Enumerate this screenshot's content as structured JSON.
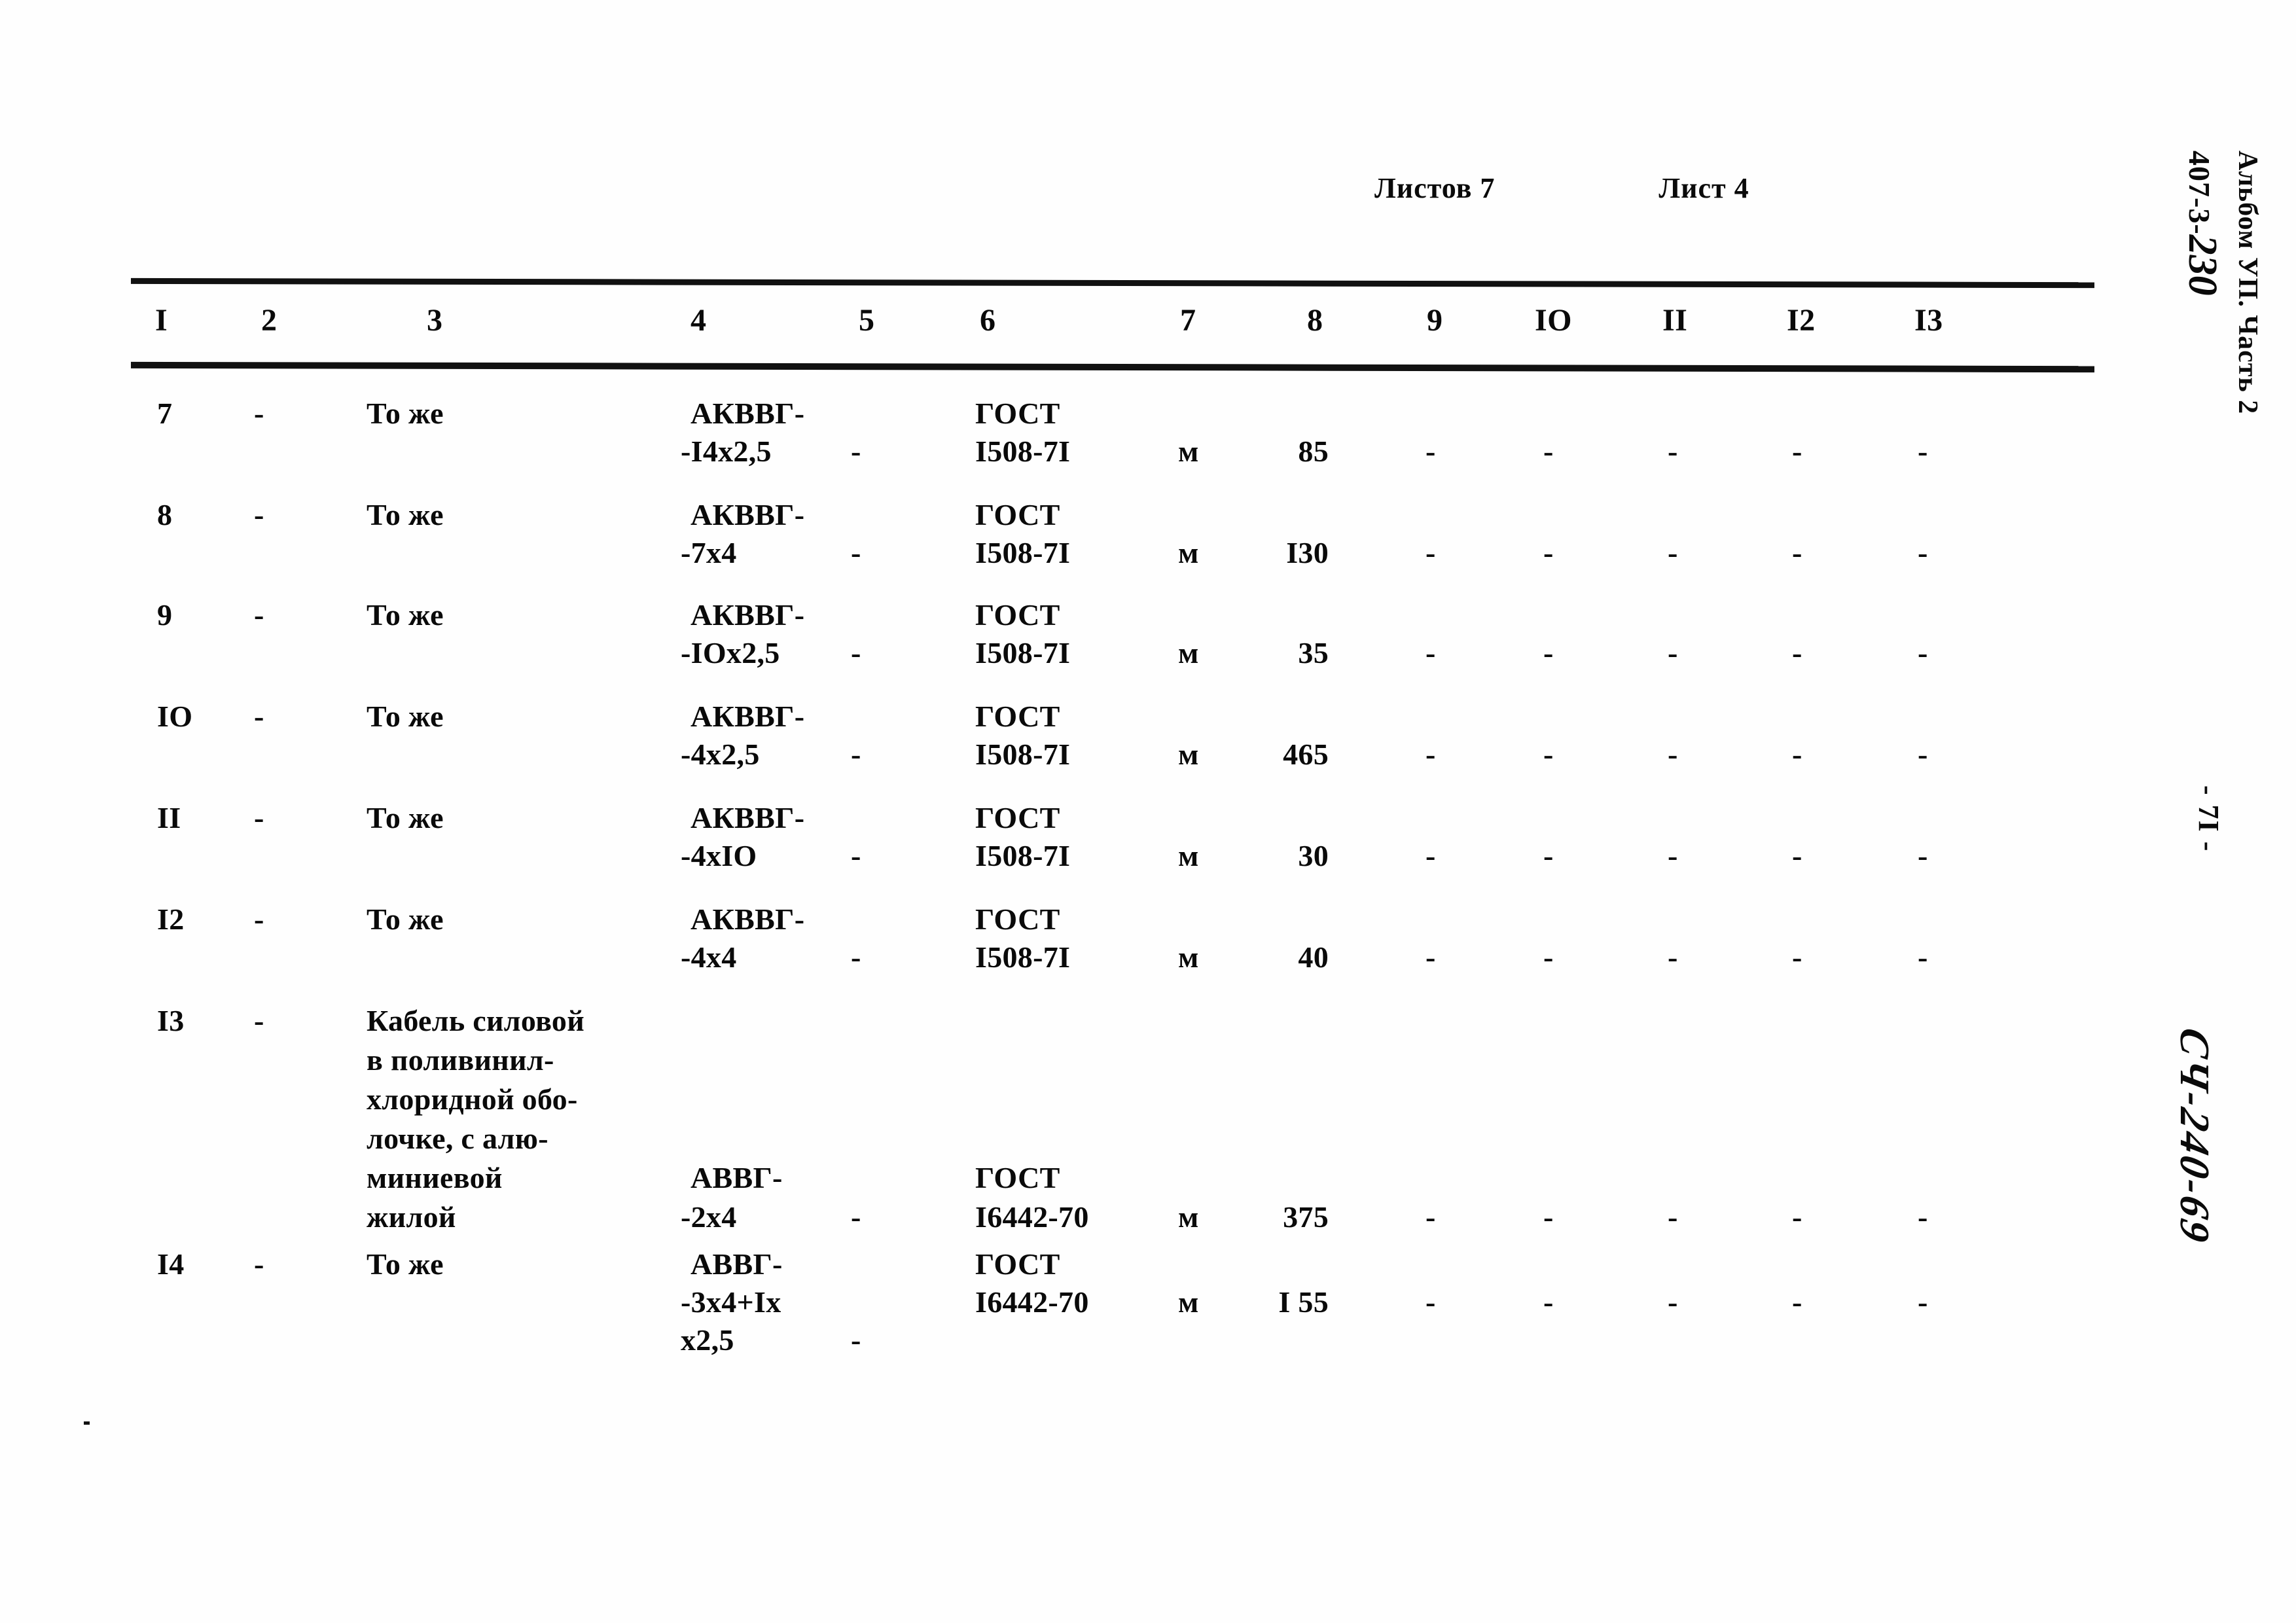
{
  "header": {
    "sheets_total_label": "Листов 7",
    "sheet_number_label": "Лист 4"
  },
  "margin": {
    "document_code": "407-3-",
    "document_code_handwritten": "230",
    "album_part": "Альбом УП. Часть 2",
    "page_number": "- 7I -",
    "stamp_handwritten": "СЧ-240-69"
  },
  "table": {
    "column_headers": [
      "I",
      "2",
      "3",
      "4",
      "5",
      "6",
      "7",
      "8",
      "9",
      "IO",
      "II",
      "I2",
      "I3"
    ],
    "rows": [
      {
        "c1": "7",
        "c2": "-",
        "c3": [
          "То же"
        ],
        "c4": [
          "АКВВГ-",
          "-I4х2,5"
        ],
        "c5": "-",
        "c6": [
          "ГОСТ",
          "I508-7I"
        ],
        "c7": "м",
        "c8": "85",
        "c9": "-",
        "c10": "-",
        "c11": "-",
        "c12": "-",
        "c13": "-"
      },
      {
        "c1": "8",
        "c2": "-",
        "c3": [
          "То же"
        ],
        "c4": [
          "АКВВГ-",
          "-7х4"
        ],
        "c5": "-",
        "c6": [
          "ГОСТ",
          "I508-7I"
        ],
        "c7": "м",
        "c8": "I30",
        "c9": "-",
        "c10": "-",
        "c11": "-",
        "c12": "-",
        "c13": "-"
      },
      {
        "c1": "9",
        "c2": "-",
        "c3": [
          "То же"
        ],
        "c4": [
          "АКВВГ-",
          "-IOх2,5"
        ],
        "c5": "-",
        "c6": [
          "ГОСТ",
          "I508-7I"
        ],
        "c7": "м",
        "c8": "35",
        "c9": "-",
        "c10": "-",
        "c11": "-",
        "c12": "-",
        "c13": "-"
      },
      {
        "c1": "IO",
        "c2": "-",
        "c3": [
          "То же"
        ],
        "c4": [
          "АКВВГ-",
          "-4х2,5"
        ],
        "c5": "-",
        "c6": [
          "ГОСТ",
          "I508-7I"
        ],
        "c7": "м",
        "c8": "465",
        "c9": "-",
        "c10": "-",
        "c11": "-",
        "c12": "-",
        "c13": "-"
      },
      {
        "c1": "II",
        "c2": "-",
        "c3": [
          "То же"
        ],
        "c4": [
          "АКВВГ-",
          "-4хIO"
        ],
        "c5": "-",
        "c6": [
          "ГОСТ",
          "I508-7I"
        ],
        "c7": "м",
        "c8": "30",
        "c9": "-",
        "c10": "-",
        "c11": "-",
        "c12": "-",
        "c13": "-"
      },
      {
        "c1": "I2",
        "c2": "-",
        "c3": [
          "То же"
        ],
        "c4": [
          "АКВВГ-",
          "-4х4"
        ],
        "c5": "-",
        "c6": [
          "ГОСТ",
          "I508-7I"
        ],
        "c7": "м",
        "c8": "40",
        "c9": "-",
        "c10": "-",
        "c11": "-",
        "c12": "-",
        "c13": "-"
      },
      {
        "c1": "I3",
        "c2": "-",
        "c3": [
          "Кабель силовой",
          "в поливинил-",
          "хлоридной обо-",
          "лочке, с алю-",
          "миниевой",
          "жилой"
        ],
        "c4": [
          "АВВГ-",
          "-2х4"
        ],
        "c5": "-",
        "c6": [
          "ГОСТ",
          "I6442-70"
        ],
        "c7": "м",
        "c8": "375",
        "c9": "-",
        "c10": "-",
        "c11": "-",
        "c12": "-",
        "c13": "-"
      },
      {
        "c1": "I4",
        "c2": "-",
        "c3": [
          "То же"
        ],
        "c4": [
          "АВВГ-",
          "-3х4+Iх",
          "х2,5"
        ],
        "c5": "-",
        "c6": [
          "ГОСТ",
          "I6442-70"
        ],
        "c7": "м",
        "c8": "I 55",
        "c9": "-",
        "c10": "-",
        "c11": "-",
        "c12": "-",
        "c13": "-"
      }
    ]
  }
}
